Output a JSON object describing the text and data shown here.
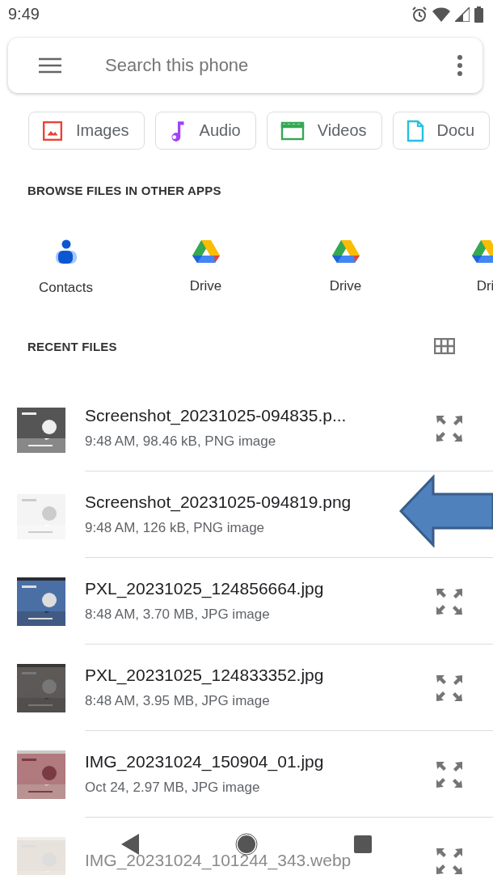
{
  "status_bar": {
    "time": "9:49"
  },
  "search": {
    "placeholder": "Search this phone"
  },
  "chips": [
    {
      "kind": "images",
      "label": "Images"
    },
    {
      "kind": "audio",
      "label": "Audio"
    },
    {
      "kind": "videos",
      "label": "Videos"
    },
    {
      "kind": "documents",
      "label": "Docu"
    }
  ],
  "browse": {
    "title": "BROWSE FILES IN OTHER APPS",
    "apps": [
      {
        "kind": "contacts",
        "label": "Contacts"
      },
      {
        "kind": "drive",
        "label": "Drive"
      },
      {
        "kind": "drive",
        "label": "Drive"
      },
      {
        "kind": "drive",
        "label": "Dri"
      }
    ]
  },
  "recent": {
    "title": "RECENT FILES",
    "files": [
      {
        "name": "Screenshot_20231025-094835.p...",
        "details": "9:48 AM, 98.46 kB, PNG image",
        "pointed": false
      },
      {
        "name": "Screenshot_20231025-094819.png",
        "details": "9:48 AM, 126 kB, PNG image",
        "pointed": true
      },
      {
        "name": "PXL_20231025_124856664.jpg",
        "details": "8:48 AM, 3.70 MB, JPG image",
        "pointed": false
      },
      {
        "name": "PXL_20231025_124833352.jpg",
        "details": "8:48 AM, 3.95 MB, JPG image",
        "pointed": false
      },
      {
        "name": "IMG_20231024_150904_01.jpg",
        "details": "Oct 24, 2.97 MB, JPG image",
        "pointed": false
      },
      {
        "name": "IMG_20231024_101244_343.webp",
        "pointed": false
      }
    ]
  }
}
